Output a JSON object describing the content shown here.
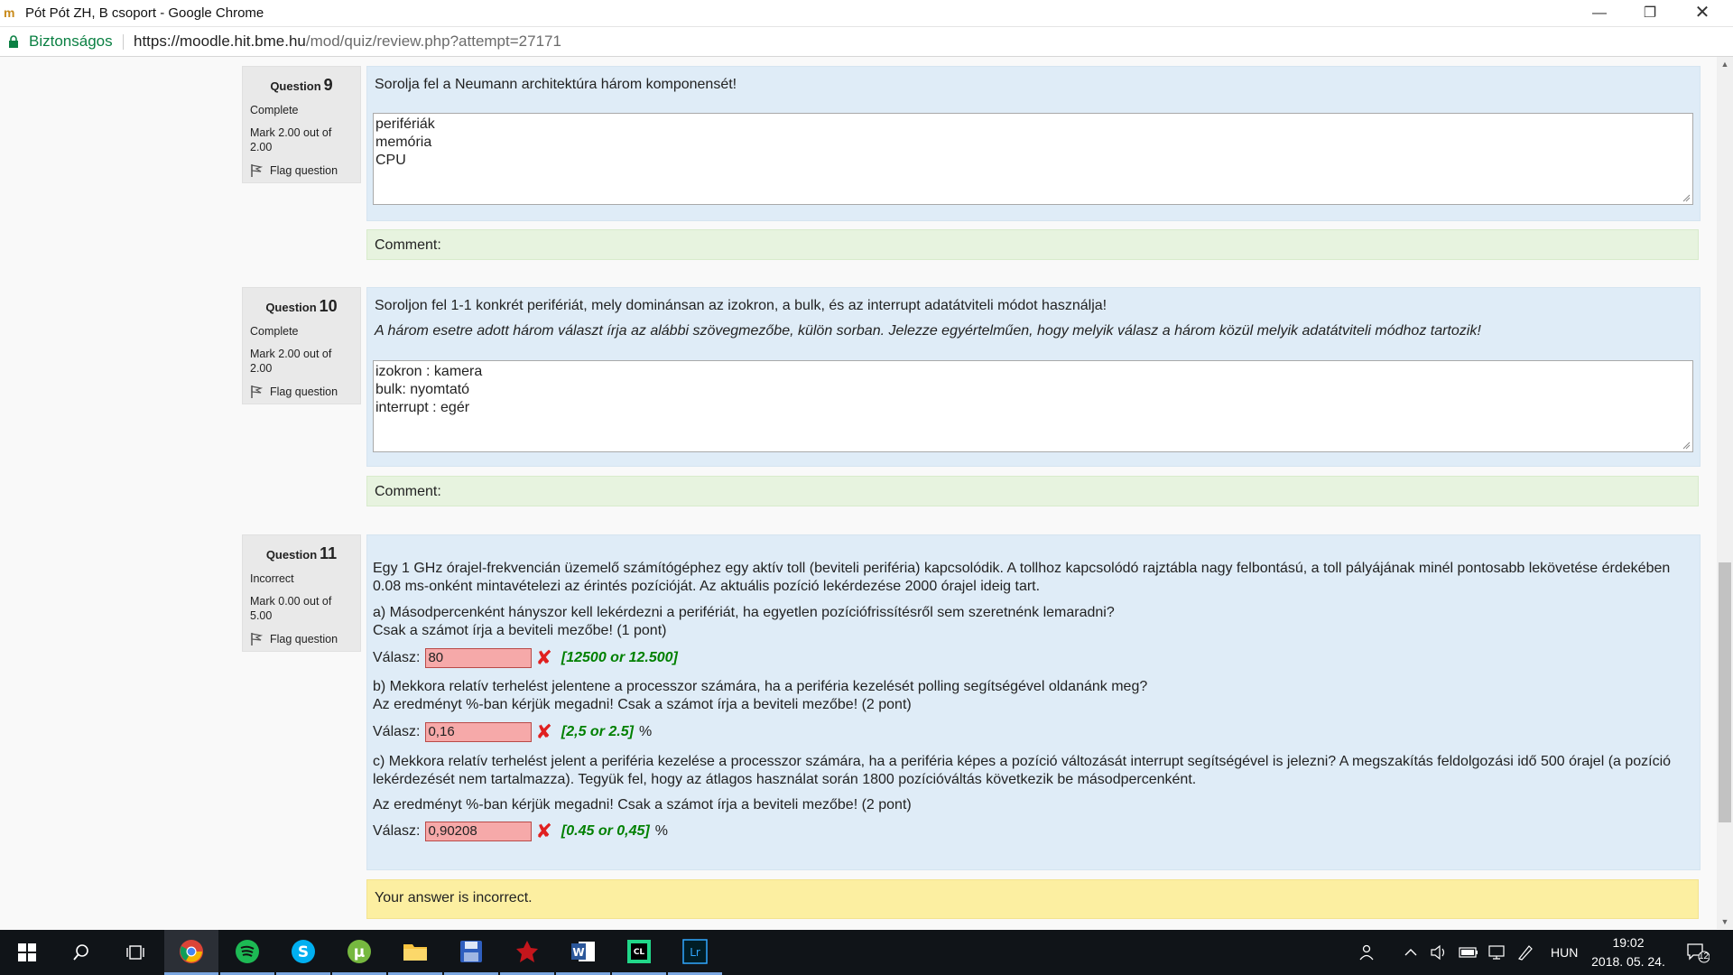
{
  "window": {
    "title": "Pót Pót ZH, B csoport - Google Chrome",
    "minimize_symbol": "—",
    "maximize_symbol": "❐",
    "close_symbol": "✕"
  },
  "address_bar": {
    "secure_label": "Biztonságos",
    "url_host": "https://moodle.hit.bme.hu",
    "url_path": "/mod/quiz/review.php?attempt=27171"
  },
  "questions": [
    {
      "label": "Question",
      "number": "9",
      "state": "Complete",
      "grade": "Mark 2.00 out of 2.00",
      "flag_label": "Flag question",
      "text": "Sorolja fel a Neumann architektúra három komponensét!",
      "answer_lines": [
        "perifériák",
        "memória",
        "CPU"
      ],
      "comment": "Comment:"
    },
    {
      "label": "Question",
      "number": "10",
      "state": "Complete",
      "grade": "Mark 2.00 out of 2.00",
      "flag_label": "Flag question",
      "text": "Soroljon fel 1-1 konkrét perifériát, mely dominánsan az izokron, a bulk, és az interrupt adatátviteli módot használja!",
      "instruction": "A három esetre adott három választ írja az alábbi szövegmezőbe, külön sorban. Jelezze egyértelműen, hogy melyik válasz a három közül melyik adatátviteli módhoz tartozik!",
      "answer_lines": [
        "izokron : kamera",
        "bulk: nyomtató",
        "interrupt : egér"
      ],
      "comment": "Comment:"
    },
    {
      "label": "Question",
      "number": "11",
      "state": "Incorrect",
      "grade": "Mark 0.00 out of 5.00",
      "flag_label": "Flag question",
      "intro": "Egy 1 GHz órajel-frekvencián üzemelő számítógéphez egy aktív toll (beviteli periféria) kapcsolódik. A tollhoz kapcsolódó rajztábla nagy felbontású, a toll pályájának minél pontosabb lekövetése érdekében 0.08 ms-onként mintavételezi az érintés pozícióját. Az aktuális pozíció lekérdezése 2000 órajel ideig tart.",
      "part_a_line1": "a) Másodpercenként hányszor kell lekérdezni a perifériát, ha egyetlen pozíciófrissítésről sem szeretnénk lemaradni?",
      "part_a_line2": "Csak a számot írja a beviteli mezőbe! (1 pont)",
      "part_b_line1": "b) Mekkora relatív terhelést jelentene a processzor számára, ha a periféria kezelését polling segítségével oldanánk meg?",
      "part_b_line2": "Az eredményt %-ban kérjük megadni! Csak a számot írja a beviteli mezőbe! (2 pont)",
      "part_c_line1": "c) Mekkora relatív terhelést jelent a periféria kezelése a processzor számára, ha a periféria képes a pozíció változását interrupt segítségével is jelezni? A megszakítás feldolgozási idő 500 órajel (a pozíció lekérdezését nem tartalmazza). Tegyük fel, hogy az átlagos használat során 1800 pozícióváltás következik be másodpercenként.",
      "part_c_line2": "Az eredményt %-ban kérjük megadni! Csak a számot írja a beviteli mezőbe! (2 pont)",
      "answers": [
        {
          "label": "Válasz:",
          "value": "80",
          "mark": "✘",
          "correct": "[12500 or 12.500]",
          "unit": ""
        },
        {
          "label": "Válasz:",
          "value": "0,16",
          "mark": "✘",
          "correct": "[2,5 or 2.5]",
          "unit": "%"
        },
        {
          "label": "Válasz:",
          "value": "0,90208",
          "mark": "✘",
          "correct": "[0.45 or 0,45]",
          "unit": "%"
        }
      ],
      "feedback": "Your answer is incorrect."
    }
  ],
  "taskbar": {
    "apps": [
      "start-icon",
      "search-icon",
      "task-view-icon",
      "chrome-icon",
      "spotify-icon",
      "skype-icon",
      "utorrent-icon",
      "file-explorer-icon",
      "save-disk-icon",
      "game-icon",
      "word-icon",
      "clion-icon",
      "lightroom-icon"
    ],
    "language": "HUN",
    "time": "19:02",
    "date": "2018. 05. 24.",
    "notification_count": "12"
  }
}
